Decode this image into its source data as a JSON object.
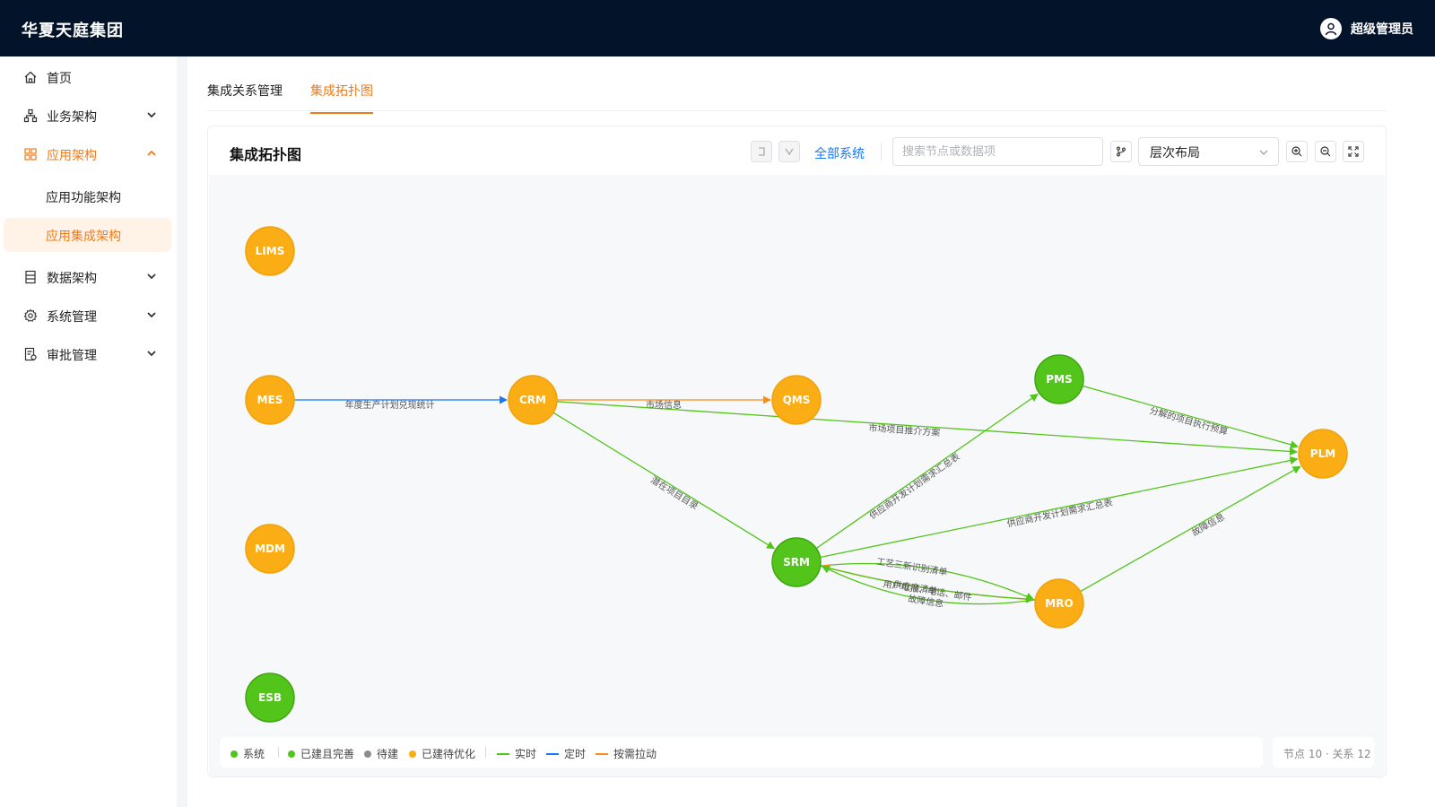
{
  "app": {
    "brand": "华夏天庭集团",
    "user": "超级管理员"
  },
  "sidebar": {
    "items": [
      {
        "label": "首页",
        "icon": "home-icon"
      },
      {
        "label": "业务架构",
        "icon": "org-chart-icon"
      },
      {
        "label": "应用架构",
        "icon": "grid-icon"
      },
      {
        "label": "数据架构",
        "icon": "database-icon"
      },
      {
        "label": "系统管理",
        "icon": "gear-icon"
      },
      {
        "label": "审批管理",
        "icon": "approval-icon"
      }
    ],
    "sub_items": [
      {
        "label": "应用功能架构"
      },
      {
        "label": "应用集成架构"
      }
    ]
  },
  "tabs": [
    {
      "label": "集成关系管理"
    },
    {
      "label": "集成拓扑图"
    }
  ],
  "card": {
    "title": "集成拓扑图",
    "all_systems": "全部系统",
    "search_placeholder": "搜索节点或数据项",
    "layout": "层次布局"
  },
  "colors": {
    "accent": "#f07a16",
    "green": "#52c41a",
    "orange": "#faad14",
    "gray": "#8c8c8c",
    "blue": "#1677ff",
    "edge_orange": "#fa8c16"
  },
  "legend": {
    "system": "系统",
    "built_complete": "已建且完善",
    "pending": "待建",
    "built_optimize": "已建待优化",
    "realtime": "实时",
    "scheduled": "定时",
    "on_demand": "按需拉动"
  },
  "stats": "节点 10 · 关系 12",
  "graph": {
    "nodes": [
      {
        "id": "LIMS",
        "status": "optimize"
      },
      {
        "id": "MES",
        "status": "optimize"
      },
      {
        "id": "MDM",
        "status": "optimize"
      },
      {
        "id": "ESB",
        "status": "complete"
      },
      {
        "id": "CRM",
        "status": "optimize"
      },
      {
        "id": "QMS",
        "status": "optimize"
      },
      {
        "id": "SRM",
        "status": "complete"
      },
      {
        "id": "PMS",
        "status": "complete"
      },
      {
        "id": "MRO",
        "status": "optimize"
      },
      {
        "id": "PLM",
        "status": "optimize"
      }
    ],
    "edges": [
      {
        "from": "MES",
        "to": "CRM",
        "label": "年度生产计划兑现统计",
        "type": "scheduled"
      },
      {
        "from": "CRM",
        "to": "QMS",
        "label": "市场信息",
        "type": "on_demand"
      },
      {
        "from": "CRM",
        "to": "PLM",
        "label": "市场项目推介方案",
        "type": "realtime"
      },
      {
        "from": "CRM",
        "to": "SRM",
        "label": "潜在项目目录",
        "type": "realtime"
      },
      {
        "from": "SRM",
        "to": "PMS",
        "label": "供应商开发计划需求汇总表",
        "type": "realtime"
      },
      {
        "from": "PMS",
        "to": "PLM",
        "label": "分解的项目执行预算",
        "type": "realtime"
      },
      {
        "from": "SRM",
        "to": "PLM",
        "label": "供应商开发计划需求汇总表",
        "type": "realtime"
      },
      {
        "from": "MRO",
        "to": "PLM",
        "label": "故障信息",
        "type": "realtime"
      },
      {
        "from": "SRM",
        "to": "MRO",
        "label": "工艺三新识别清单",
        "type": "realtime"
      },
      {
        "from": "MRO",
        "to": "SRM",
        "label": "用户电报、电话、邮件",
        "type": "on_demand"
      },
      {
        "from": "SRM",
        "to": "MRO",
        "label": "供应商清单",
        "type": "realtime"
      },
      {
        "from": "MRO",
        "to": "SRM",
        "label": "故障信息",
        "type": "realtime"
      }
    ]
  }
}
